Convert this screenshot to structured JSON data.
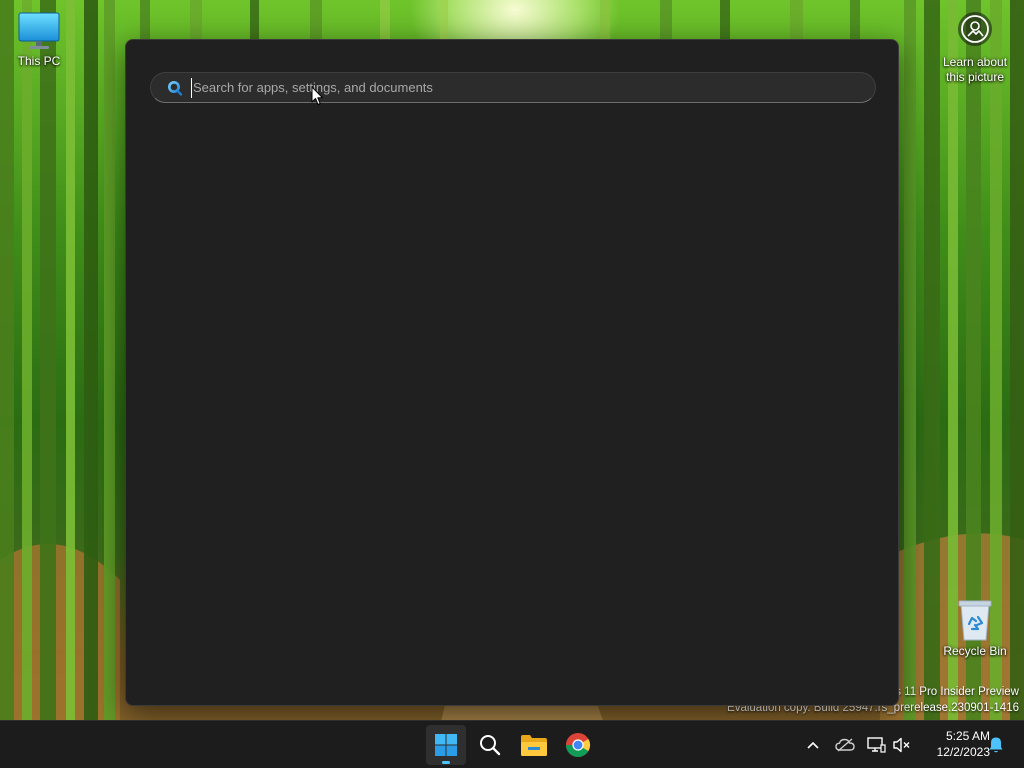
{
  "desktop": {
    "this_pc_label": "This PC",
    "recycle_bin_label": "Recycle Bin",
    "learn_label_line1": "Learn about",
    "learn_label_line2": "this picture",
    "watermark_line1": "s 11 Pro Insider Preview",
    "watermark_line2": "Evaluation copy. Build 25947.rs_prerelease.230901-1416"
  },
  "search": {
    "placeholder": "Search for apps, settings, and documents",
    "value": "",
    "icon": "search-icon"
  },
  "taskbar": {
    "pinned": [
      {
        "name": "start-button",
        "icon": "windows-logo-icon"
      },
      {
        "name": "search-button",
        "icon": "search-icon"
      },
      {
        "name": "file-explorer-button",
        "icon": "folder-icon"
      },
      {
        "name": "chrome-button",
        "icon": "chrome-icon"
      }
    ],
    "tray": [
      "chevron-up-icon",
      "onedrive-icon",
      "network-icon",
      "volume-muted-icon"
    ],
    "time": "5:25 AM",
    "date": "12/2/2023",
    "notification_icon": "bell-icon"
  },
  "colors": {
    "accent": "#4cc2ff",
    "panel_bg": "#202020",
    "taskbar_bg": "#1c1c1c"
  }
}
